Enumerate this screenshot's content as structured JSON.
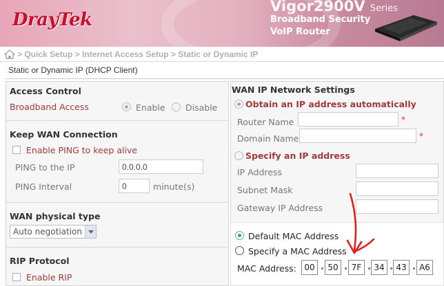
{
  "header": {
    "brand": "DrayTek",
    "model": "Vigor2900V",
    "model_suffix": "Series",
    "line1": "Broadband Security",
    "line2": "VoIP Router",
    "colors": {
      "brand_red": "#c8102e",
      "banner_pink": "#e8a6b8"
    }
  },
  "breadcrumb": {
    "icon": "home-icon",
    "text": "> Quick Setup > Internet Access Setup > Static or Dynamic IP"
  },
  "page_title": "Static or Dynamic IP (DHCP Client)",
  "access_control": {
    "title": "Access Control",
    "label": "Broadband Access",
    "enable_label": "Enable",
    "disable_label": "Disable",
    "selected": "Enable"
  },
  "keep_wan": {
    "title": "Keep WAN Connection",
    "ping_checkbox_label": "Enable PING to keep alive",
    "ping_checked": false,
    "ping_ip_label": "PING to the IP",
    "ping_ip_value": "0.0.0.0",
    "ping_interval_label": "PING Interval",
    "ping_interval_value": "0",
    "ping_interval_unit": "minute(s)"
  },
  "wan_physical": {
    "title": "WAN physical type",
    "selected": "Auto negotiation"
  },
  "rip": {
    "title": "RIP Protocol",
    "checkbox_label": "Enable RIP",
    "checked": false
  },
  "wan_ip": {
    "title": "WAN IP Network Settings",
    "auto_label": "Obtain an IP address automatically",
    "auto_selected": true,
    "router_name_label": "Router Name",
    "router_name_value": "",
    "domain_name_label": "Domain Name",
    "domain_name_value": "",
    "required_mark": "*",
    "specify_label": "Specify an IP address",
    "ip_label": "IP Address",
    "subnet_label": "Subnet Mask",
    "gateway_label": "Gateway IP Address"
  },
  "mac": {
    "default_label": "Default MAC Address",
    "specify_label": "Specify a MAC Address",
    "default_selected": true,
    "address_label": "MAC Address:",
    "octets": [
      "00",
      "50",
      "7F",
      "34",
      "43",
      "A6"
    ]
  }
}
